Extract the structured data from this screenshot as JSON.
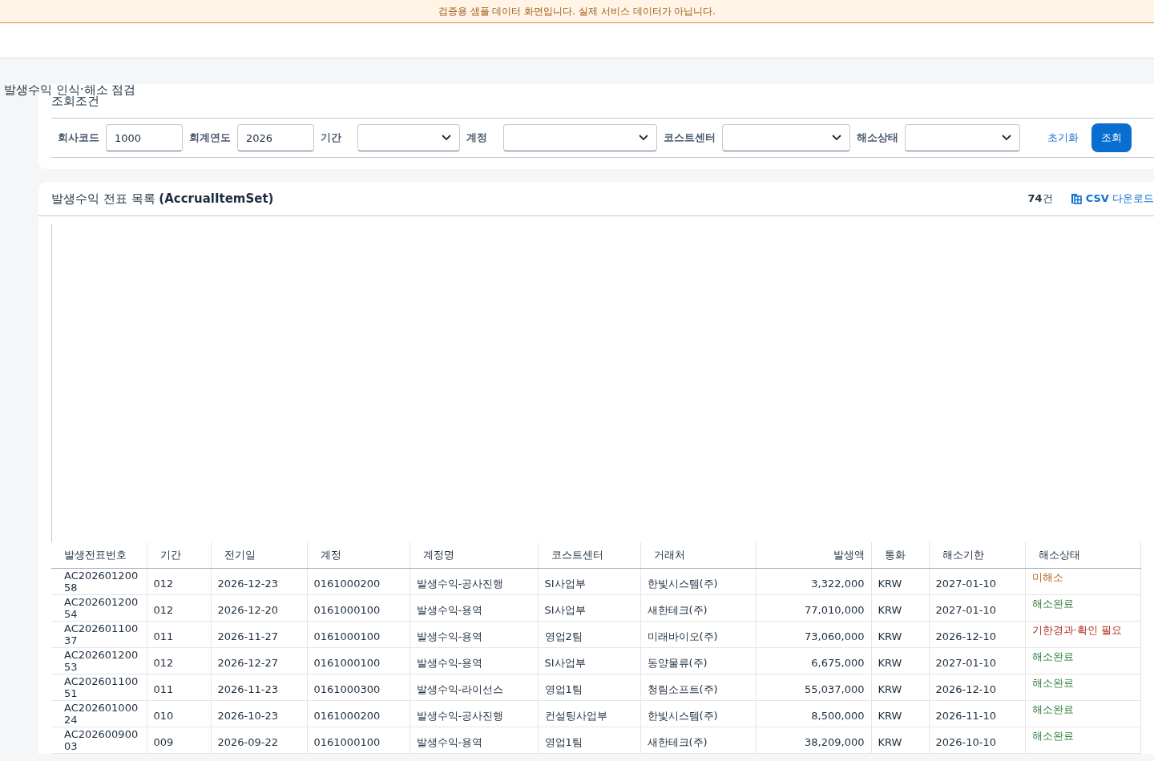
{
  "banner": "검증용 샘플 데이터 화면입니다. 실제 서비스 데이터가 아닙니다.",
  "page_title": "발생수익 인식·해소 점검",
  "filter": {
    "title": "조회조건",
    "fields": [
      {
        "kind": "input",
        "label": "회사코드",
        "value": "1000"
      },
      {
        "kind": "input",
        "label": "회계연도",
        "value": "2026"
      },
      {
        "kind": "select",
        "label": "기간"
      },
      {
        "kind": "select",
        "label": "계정"
      },
      {
        "kind": "select",
        "label": "코스트센터"
      },
      {
        "kind": "select",
        "label": "해소상태"
      }
    ],
    "reset": "초기화",
    "search": "조회"
  },
  "list": {
    "title": "발생수익 전표 목록 ",
    "title_bold": "(AccrualItemSet)",
    "count": "74",
    "count_unit": "건",
    "csv_prefix": "CSV",
    "csv": " 다운로드",
    "columns": [
      "발생전표번호",
      "기간",
      "전기일",
      "계정",
      "계정명",
      "코스트센터",
      "거래처",
      "발생액",
      "통화",
      "해소기한",
      "해소상태"
    ],
    "rows": [
      {
        "cells": [
          "AC202601200 58",
          "012",
          "2026-12-23",
          "0161000200",
          "발생수익-공사진행",
          "SI사업부",
          "한빛시스템(주)",
          "3,322,000",
          "KRW",
          "2027-01-10",
          "미해소"
        ],
        "color": "#b8651b"
      },
      {
        "cells": [
          "AC202601200 54",
          "012",
          "2026-12-20",
          "0161000100",
          "발생수익-용역",
          "SI사업부",
          "새한테크(주)",
          "77,010,000",
          "KRW",
          "2027-01-10",
          "해소완료"
        ],
        "color": "#2e7d3c"
      },
      {
        "cells": [
          "AC202601100 37",
          "011",
          "2026-11-27",
          "0161000100",
          "발생수익-용역",
          "영업2팀",
          "미래바이오(주)",
          "73,060,000",
          "KRW",
          "2026-12-10",
          "기한경과·확인 필요"
        ],
        "color": "#b3261e"
      },
      {
        "cells": [
          "AC202601200 53",
          "012",
          "2026-12-27",
          "0161000100",
          "발생수익-용역",
          "SI사업부",
          "동양물류(주)",
          "6,675,000",
          "KRW",
          "2027-01-10",
          "해소완료"
        ],
        "color": "#2e7d3c"
      },
      {
        "cells": [
          "AC202601100 51",
          "011",
          "2026-11-23",
          "0161000300",
          "발생수익-라이선스",
          "영업1팀",
          "청림소프트(주)",
          "55,037,000",
          "KRW",
          "2026-12-10",
          "해소완료"
        ],
        "color": "#2e7d3c"
      },
      {
        "cells": [
          "AC202601000 24",
          "010",
          "2026-10-23",
          "0161000200",
          "발생수익-공사진행",
          "컨설팅사업부",
          "한빛시스템(주)",
          "8,500,000",
          "KRW",
          "2026-11-10",
          "해소완료"
        ],
        "color": "#2e7d3c"
      },
      {
        "cells": [
          "AC202600900 03",
          "009",
          "2026-09-22",
          "0161000100",
          "발생수익-용역",
          "영업1팀",
          "새한테크(주)",
          "38,209,000",
          "KRW",
          "2026-10-10",
          "해소완료"
        ],
        "color": "#2e7d3c"
      }
    ]
  }
}
